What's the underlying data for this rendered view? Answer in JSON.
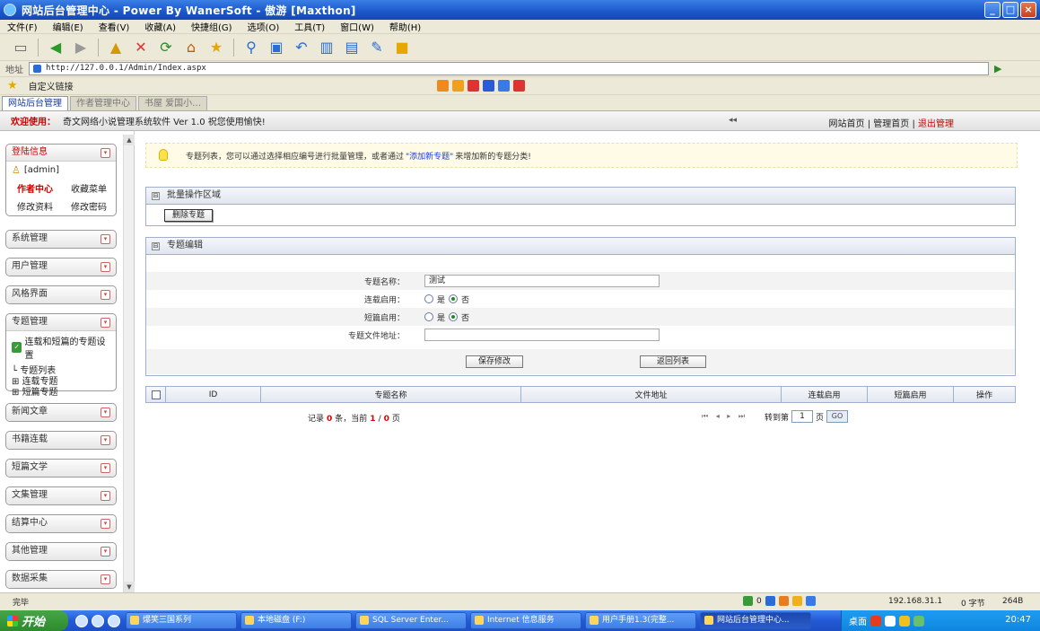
{
  "window": {
    "title": "网站后台管理中心 - Power By WanerSoft - 傲游 [Maxthon]",
    "minimize": "_",
    "restore": "□",
    "close": "×"
  },
  "menu": [
    "文件(F)",
    "编辑(E)",
    "查看(V)",
    "收藏(A)",
    "快捷组(G)",
    "选项(O)",
    "工具(T)",
    "窗口(W)",
    "帮助(H)"
  ],
  "address": {
    "label": "地址",
    "url": "http://127.0.0.1/Admin/Index.aspx"
  },
  "favorites": {
    "link": "自定义链接"
  },
  "tabs": [
    "网站后台管理",
    "作者管理中心",
    "书屋 爱国小…"
  ],
  "header": {
    "welcome": "欢迎使用：",
    "app": "奇文网络小说管理系统软件  Ver 1.0   祝您使用愉快!",
    "collapse": "◂◂",
    "link_home": "网站首页",
    "link_admin_home": "管理首页",
    "link_logout": "退出管理",
    "divider": "|"
  },
  "sidebar": {
    "login": {
      "title": "登陆信息",
      "user": "[admin]",
      "links": [
        "作者中心",
        "收藏菜单",
        "修改资料",
        "修改密码"
      ]
    },
    "sections_top": [
      "系统管理",
      "用户管理",
      "风格界面"
    ],
    "topic": {
      "title": "专题管理",
      "sub": "连载和短篇的专题设置",
      "tree": [
        "专题列表",
        "连载专题",
        "短篇专题"
      ]
    },
    "sections_bottom": [
      "新闻文章",
      "书籍连载",
      "短篇文学",
      "文集管理",
      "结算中心",
      "其他管理",
      "数据采集"
    ],
    "toggle": "▾"
  },
  "notice": {
    "pre": "专题列表，您可以通过选择相应编号进行批量管理，或者通过",
    "link": "\"添加新专题\"",
    "post": "来增加新的专题分类!"
  },
  "batch": {
    "title": "批量操作区域",
    "delete_btn": "删除专题"
  },
  "edit": {
    "title": "专题编辑",
    "name_label": "专题名称：",
    "name_value": "测试",
    "serial_label": "连载启用：",
    "short_label": "短篇启用：",
    "yes": "是",
    "no": "否",
    "file_label": "专题文件地址：",
    "file_value": "",
    "save_btn": "保存修改",
    "back_btn": "返回列表"
  },
  "table": {
    "columns": [
      "ID",
      "专题名称",
      "文件地址",
      "连载启用",
      "短篇启用",
      "操作"
    ]
  },
  "pager": {
    "rec_label": "记录",
    "count": "0",
    "count_unit": "条，当前",
    "page": "1",
    "page_sep": "/",
    "total": "0",
    "page_unit": "页",
    "nav": "⏮ ◂ ▸ ⏭",
    "jump_label": "转到第",
    "jump_value": "1",
    "jump_unit": "页",
    "go": "GO"
  },
  "status": {
    "text": "完毕",
    "count": "0",
    "ip": "192.168.31.1",
    "bytes": "0 字节",
    "size": "264B"
  },
  "taskbar": {
    "start": "开始",
    "items": [
      "爆笑三国系列",
      "本地磁盘 (F:)",
      "SQL Server Enter...",
      "Internet 信息服务",
      "用户手册1.3(完整...",
      "网站后台管理中心..."
    ],
    "tray_label": "桌面",
    "clock": "20:47"
  }
}
